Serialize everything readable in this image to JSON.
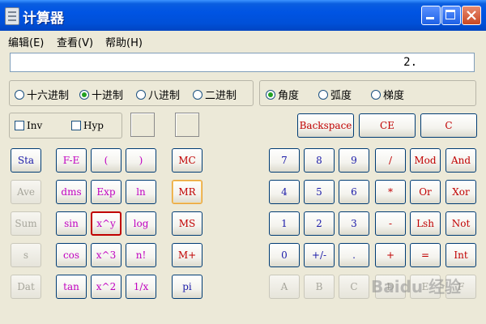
{
  "window": {
    "title": "计算器"
  },
  "menu": [
    {
      "label": "编辑(E)"
    },
    {
      "label": "查看(V)"
    },
    {
      "label": "帮助(H)"
    }
  ],
  "display": {
    "value": "2."
  },
  "number_base": [
    {
      "label": "十六进制",
      "selected": false
    },
    {
      "label": "十进制",
      "selected": true
    },
    {
      "label": "八进制",
      "selected": false
    },
    {
      "label": "二进制",
      "selected": false
    }
  ],
  "angle_unit": [
    {
      "label": "角度",
      "selected": true
    },
    {
      "label": "弧度",
      "selected": false
    },
    {
      "label": "梯度",
      "selected": false
    }
  ],
  "checkboxes": [
    {
      "label": "Inv",
      "checked": false
    },
    {
      "label": "Hyp",
      "checked": false
    }
  ],
  "edit_buttons": [
    "Backspace",
    "CE",
    "C"
  ],
  "stat_column": [
    "Sta",
    "Ave",
    "Sum",
    "s",
    "Dat"
  ],
  "sci_columns": [
    [
      "F-E",
      "dms",
      "sin",
      "cos",
      "tan"
    ],
    [
      "(",
      "Exp",
      "x^y",
      "x^3",
      "x^2"
    ],
    [
      ")",
      "ln",
      "log",
      "n!",
      "1/x"
    ]
  ],
  "memory_column": [
    "MC",
    "MR",
    "MS",
    "M+",
    "pi"
  ],
  "keypad_rows": [
    [
      "7",
      "8",
      "9",
      "/",
      "Mod",
      "And"
    ],
    [
      "4",
      "5",
      "6",
      "*",
      "Or",
      "Xor"
    ],
    [
      "1",
      "2",
      "3",
      "-",
      "Lsh",
      "Not"
    ],
    [
      "0",
      "+/-",
      ".",
      "+",
      "=",
      "Int"
    ],
    [
      "A",
      "B",
      "C",
      "D",
      "E",
      "F"
    ]
  ],
  "colors": {
    "title_bar": "#0054e3",
    "face": "#ece9d8",
    "navy_text": "#1a1aa8",
    "magenta_text": "#c000c0",
    "red_text": "#c00000",
    "disabled_text": "#a6a59b",
    "selected_border": "#c00000"
  },
  "watermark": "Baidu 经验"
}
